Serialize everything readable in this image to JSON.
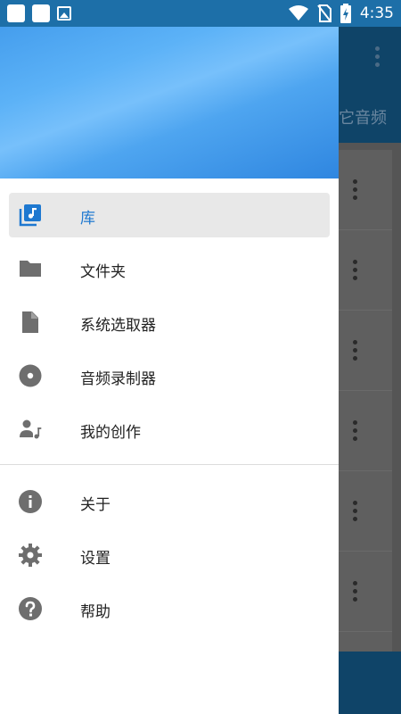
{
  "status_bar": {
    "time": "4:35"
  },
  "background": {
    "tab_label": "它音频"
  },
  "drawer": {
    "nav_items": [
      {
        "label": "库",
        "icon": "library-music-icon",
        "active": true
      },
      {
        "label": "文件夹",
        "icon": "folder-icon"
      },
      {
        "label": "系统选取器",
        "icon": "file-icon"
      },
      {
        "label": "音频录制器",
        "icon": "disc-icon"
      },
      {
        "label": "我的创作",
        "icon": "person-music-icon"
      }
    ],
    "secondary_items": [
      {
        "label": "关于",
        "icon": "info-icon"
      },
      {
        "label": "设置",
        "icon": "gear-icon"
      },
      {
        "label": "帮助",
        "icon": "help-icon"
      }
    ]
  },
  "colors": {
    "accent": "#1e78d0",
    "icon_gray": "#6e6e6e",
    "toolbar_dark": "#0f4468",
    "status_bar": "#1d6fa8"
  }
}
